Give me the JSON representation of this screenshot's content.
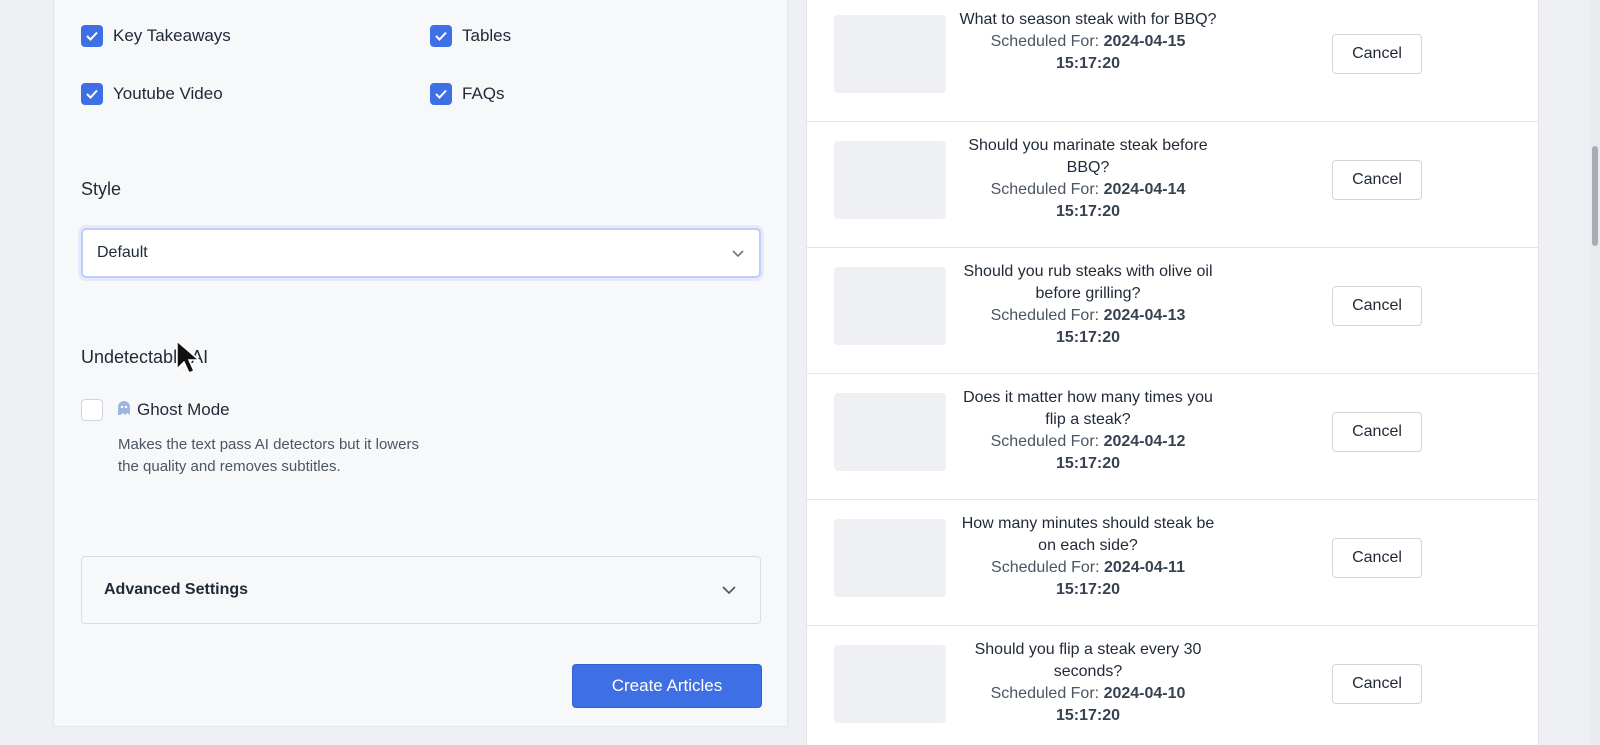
{
  "options": {
    "key_takeaways": {
      "label": "Key Takeaways",
      "checked": true
    },
    "tables": {
      "label": "Tables",
      "checked": true
    },
    "youtube_video": {
      "label": "Youtube Video",
      "checked": true
    },
    "faqs": {
      "label": "FAQs",
      "checked": true
    }
  },
  "style": {
    "title": "Style",
    "selected": "Default"
  },
  "undetectable": {
    "title": "Undetectable AI",
    "ghost_mode_label": "Ghost Mode",
    "ghost_mode_checked": false,
    "help_text": "Makes the text pass AI detectors but it lowers the quality and removes subtitles."
  },
  "advanced": {
    "label": "Advanced Settings"
  },
  "create_button": "Create Articles",
  "scheduled_prefix": "Scheduled For:",
  "cancel_label": "Cancel",
  "scheduled": [
    {
      "title": "What to season steak with for BBQ?",
      "date": "2024-04-15",
      "time": "15:17:20"
    },
    {
      "title": "Should you marinate steak before BBQ?",
      "date": "2024-04-14",
      "time": "15:17:20"
    },
    {
      "title": "Should you rub steaks with olive oil before grilling?",
      "date": "2024-04-13",
      "time": "15:17:20"
    },
    {
      "title": "Does it matter how many times you flip a steak?",
      "date": "2024-04-12",
      "time": "15:17:20"
    },
    {
      "title": "How many minutes should steak be on each side?",
      "date": "2024-04-11",
      "time": "15:17:20"
    },
    {
      "title": "Should you flip a steak every 30 seconds?",
      "date": "2024-04-10",
      "time": "15:17:20"
    }
  ],
  "colors": {
    "accent": "#3f6fe5",
    "panel_bg": "#f7f8fa",
    "page_bg": "#eef0f4"
  }
}
